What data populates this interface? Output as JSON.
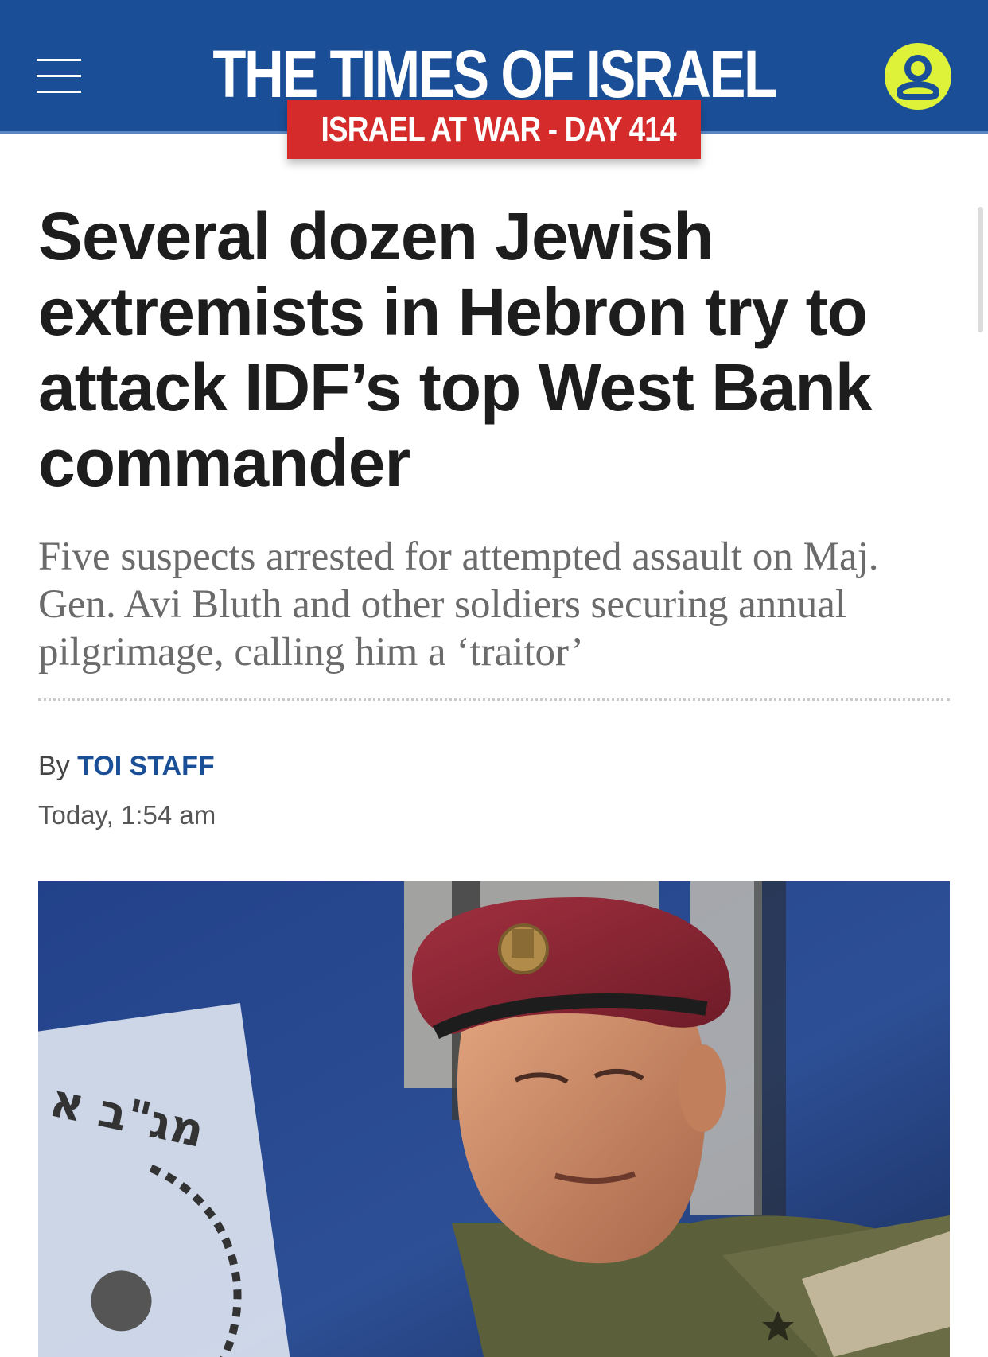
{
  "header": {
    "logo_text": "THE TIMES OF ISRAEL",
    "banner_text": "ISRAEL AT WAR - DAY 414",
    "colors": {
      "header_bg": "#1a4f97",
      "banner_bg": "#d52b2b",
      "account_icon_bg": "#dff23a"
    },
    "icons": [
      "menu-icon",
      "account-icon"
    ]
  },
  "article": {
    "headline": "Several dozen Jewish extremists in Hebron try to attack IDF’s top West Bank commander",
    "subhead": "Five suspects arrested for attempted assault on Maj. Gen. Avi Bluth and other soldiers securing annual pilgrimage, calling him a ‘traitor’",
    "byline_prefix": "By",
    "author": "TOI STAFF",
    "timestamp": "Today, 1:54 am"
  },
  "photo": {
    "sign_text": "מג\"ב א"
  }
}
